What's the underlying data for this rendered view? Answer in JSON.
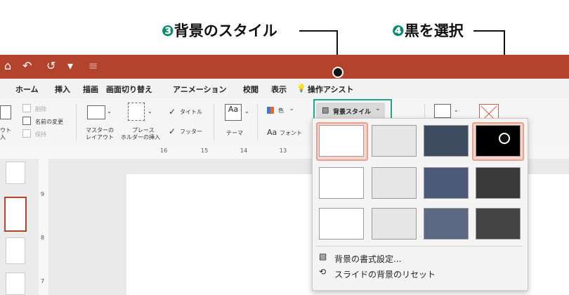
{
  "annotations": {
    "step3": {
      "num": "❸",
      "text": "背景のスタイル"
    },
    "step4": {
      "num": "❹",
      "text": "黒を選択"
    }
  },
  "qat": {
    "home_icon": "⌂",
    "undo_icon": "↶",
    "redo_icon": "↺",
    "format_icon": "▾",
    "customize_icon": "≡"
  },
  "tabs": [
    "ホーム",
    "挿入",
    "描画",
    "画面切り替え",
    "アニメーション",
    "校閲",
    "表示",
    "操作アシスト"
  ],
  "ribbon": {
    "slides": {
      "delete": "削除",
      "rename": "名前の変更",
      "keep": "保持",
      "layout_frag1": "ウト",
      "layout_frag2": "入"
    },
    "master": {
      "master_layout_l1": "マスターの",
      "master_layout_l2": "レイアウト",
      "placeholder_l1": "プレース",
      "placeholder_l2": "ホルダーの挿入",
      "title": "タイトル",
      "footer": "フッター"
    },
    "theme": {
      "theme_icon": "Aa",
      "theme_label": "テーマ"
    },
    "variants": {
      "color": "色",
      "font": "フォント"
    },
    "background": {
      "style_button": "背景スタイル"
    }
  },
  "ruler": {
    "ticks": [
      "16",
      "15",
      "14",
      "13"
    ]
  },
  "vruler": {
    "ticks": [
      "9",
      "8",
      "7"
    ]
  },
  "dropdown": {
    "swatch_colors": [
      [
        "#ffffff",
        "#e6e6e6",
        "#3f4c5f",
        "#000000"
      ],
      [
        "#ffffff",
        "#e6e6e6",
        "#4b5a78",
        "#3a3a3a"
      ],
      [
        "#ffffff",
        "#e6e6e6",
        "#5b6982",
        "#444444"
      ]
    ],
    "selected": "0,0",
    "highlighted": "0,3",
    "menu": [
      "背景の書式設定...",
      "スライドの背景のリセット"
    ]
  },
  "colors": {
    "titlebar": "#b4432e",
    "accent": "#1fa68a",
    "selection": "#e8a08f"
  }
}
